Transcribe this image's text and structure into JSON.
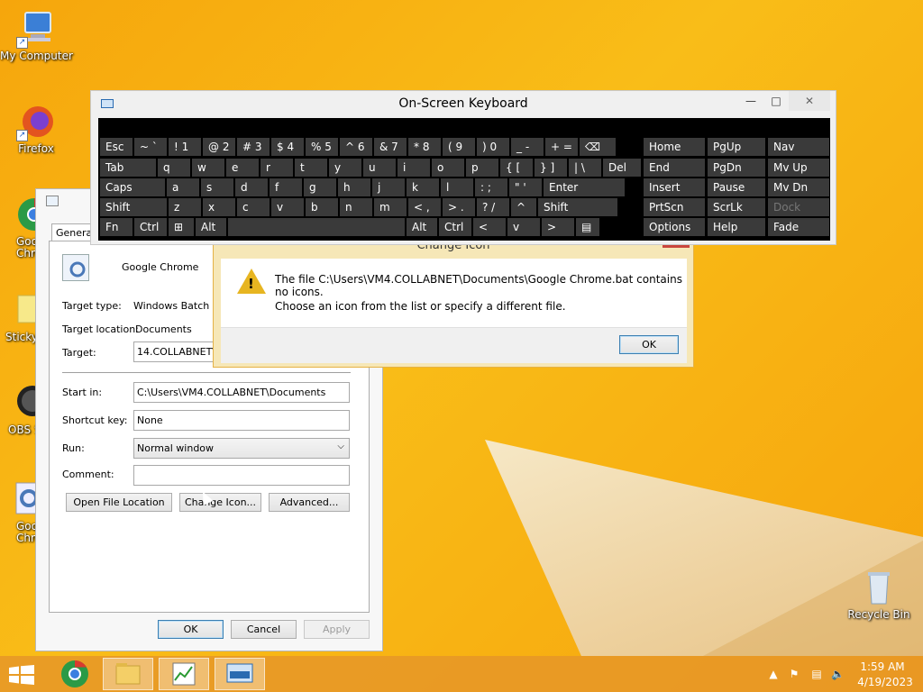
{
  "desktop": {
    "icons": [
      {
        "id": "my-computer",
        "label": "My Computer"
      },
      {
        "id": "firefox",
        "label": "Firefox"
      },
      {
        "id": "google-chrome-1",
        "label": "Goo\nChro"
      },
      {
        "id": "sticky-notes",
        "label": "Sticky"
      },
      {
        "id": "obs",
        "label": "OBS S"
      },
      {
        "id": "google-chrome-2",
        "label": "Goo\nChro"
      },
      {
        "id": "recycle-bin",
        "label": "Recycle Bin"
      }
    ]
  },
  "osk": {
    "title": "On-Screen Keyboard",
    "controls": {
      "minimize": "—",
      "maximize": "□",
      "close": "✕"
    },
    "rows": [
      [
        "Esc",
        "~ `",
        "! 1",
        "@ 2",
        "# 3",
        "$ 4",
        "% 5",
        "^ 6",
        "& 7",
        "* 8",
        "( 9",
        ") 0",
        "_ -",
        "+ =",
        "⌫"
      ],
      [
        "Tab",
        "q",
        "w",
        "e",
        "r",
        "t",
        "y",
        "u",
        "i",
        "o",
        "p",
        "{ [",
        "} ]",
        "| \\",
        "Del"
      ],
      [
        "Caps",
        "a",
        "s",
        "d",
        "f",
        "g",
        "h",
        "j",
        "k",
        "l",
        ": ;",
        "\" '",
        "Enter"
      ],
      [
        "Shift",
        "z",
        "x",
        "c",
        "v",
        "b",
        "n",
        "m",
        "< ,",
        "> .",
        "? /",
        "^",
        "Shift"
      ],
      [
        "Fn",
        "Ctrl",
        "⊞",
        "Alt",
        "",
        "Alt",
        "Ctrl",
        "<",
        "v",
        ">",
        "▤"
      ]
    ],
    "side": [
      [
        "Home",
        "PgUp",
        "Nav"
      ],
      [
        "End",
        "PgDn",
        "Mv Up"
      ],
      [
        "Insert",
        "Pause",
        "Mv Dn"
      ],
      [
        "PrtScn",
        "ScrLk",
        "Dock"
      ],
      [
        "Options",
        "Help",
        "Fade"
      ]
    ]
  },
  "props": {
    "tab": "General",
    "name": "Google Chrome",
    "target_type_label": "Target type:",
    "target_type_value": "Windows Batch File",
    "target_location_label": "Target location:",
    "target_location_value": "Documents",
    "target_label": "Target:",
    "target_value": "14.COLLABNET\\Documents\\Google Chrome.bat",
    "start_in_label": "Start in:",
    "start_in_value": "C:\\Users\\VM4.COLLABNET\\Documents",
    "shortcut_key_label": "Shortcut key:",
    "shortcut_key_value": "None",
    "run_label": "Run:",
    "run_value": "Normal window",
    "comment_label": "Comment:",
    "comment_value": "",
    "buttons": {
      "open_location": "Open File Location",
      "change_icon": "Change Icon...",
      "advanced": "Advanced..."
    },
    "footer": {
      "ok": "OK",
      "cancel": "Cancel",
      "apply": "Apply"
    }
  },
  "dialog": {
    "title": "Change Icon",
    "line1": "The file C:\\Users\\VM4.COLLABNET\\Documents\\Google Chrome.bat contains no icons.",
    "line2": "Choose an icon from the list or specify a different file.",
    "ok": "OK"
  },
  "taskbar": {
    "time": "1:59 AM",
    "date": "4/19/2023"
  }
}
